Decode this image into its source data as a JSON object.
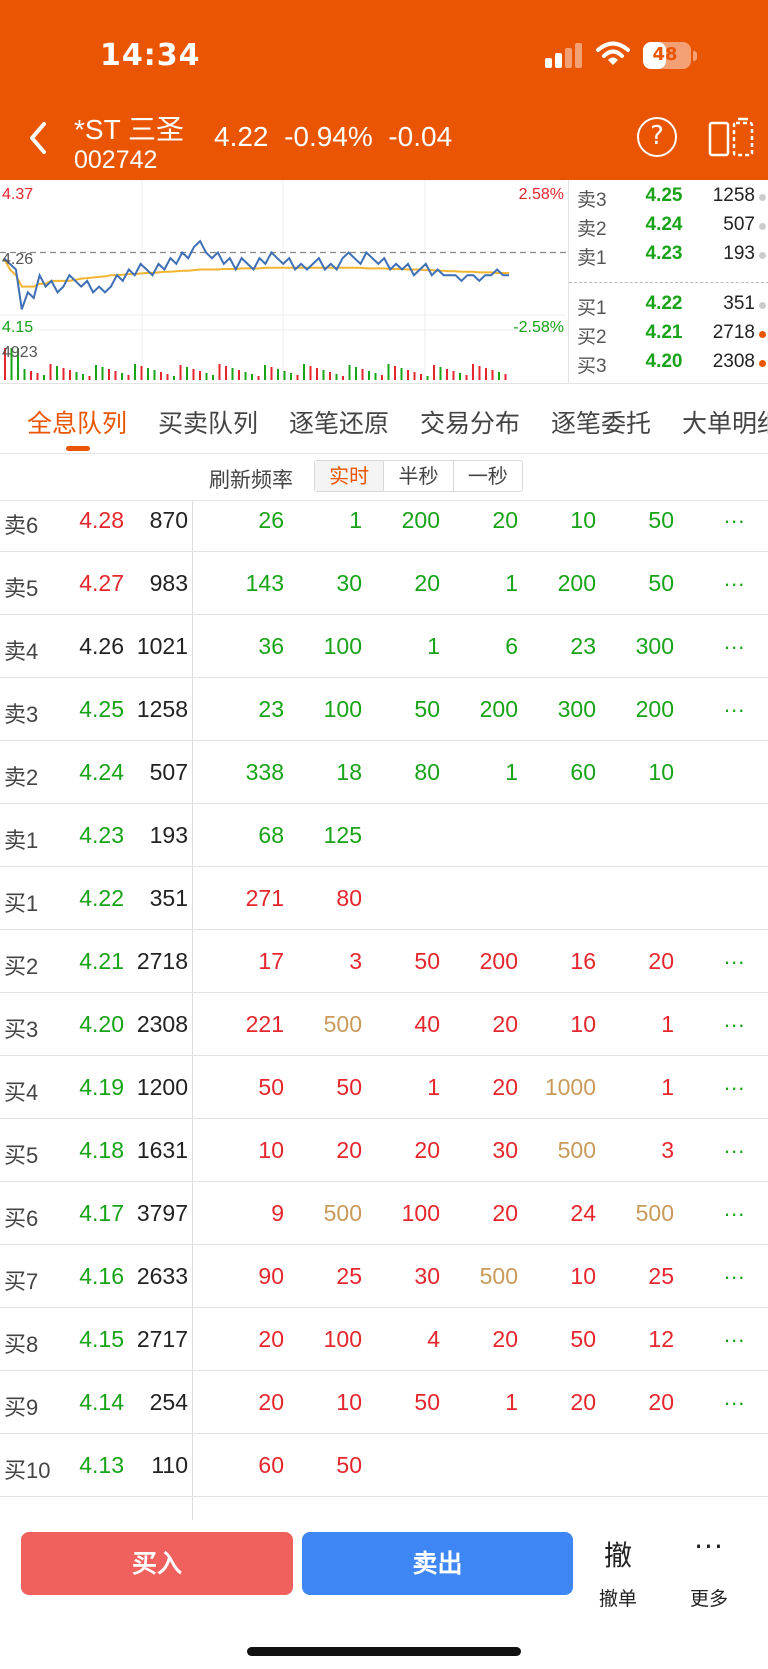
{
  "status_bar": {
    "time": "14:34",
    "battery": "48",
    "battery_level": 0.48
  },
  "header": {
    "name": "*ST 三圣",
    "code": "002742",
    "price": "4.22",
    "change_pct": "-0.94%",
    "change": "-0.04",
    "help_icon": "?"
  },
  "chart": {
    "high_label": "4.37",
    "mid_label": "4.26",
    "low_label": "4.15",
    "up_pct": "2.58%",
    "down_pct": "-2.58%",
    "volume_label": "4923"
  },
  "chart_data": {
    "type": "line",
    "ylim": [
      4.15,
      4.37
    ],
    "reference": 4.26,
    "series": [
      {
        "color": "#3f6fb5",
        "values": [
          4.25,
          4.24,
          4.23,
          4.16,
          4.19,
          4.18,
          4.22,
          4.2,
          4.21,
          4.19,
          4.2,
          4.22,
          4.21,
          4.2,
          4.21,
          4.19,
          4.2,
          4.19,
          4.2,
          4.22,
          4.21,
          4.23,
          4.22,
          4.24,
          4.23,
          4.22,
          4.24,
          4.23,
          4.25,
          4.24,
          4.26,
          4.25,
          4.27,
          4.28,
          4.26,
          4.25,
          4.26,
          4.24,
          4.25,
          4.23,
          4.25,
          4.24,
          4.23,
          4.25,
          4.24,
          4.26,
          4.25,
          4.24,
          4.25,
          4.23,
          4.24,
          4.23,
          4.24,
          4.25,
          4.23,
          4.24,
          4.23,
          4.25,
          4.26,
          4.25,
          4.24,
          4.26,
          4.25,
          4.24,
          4.25,
          4.23,
          4.24,
          4.23,
          4.24,
          4.22,
          4.23,
          4.24,
          4.22,
          4.23,
          4.22,
          4.22,
          4.22,
          4.21,
          4.22,
          4.22,
          4.21,
          4.22,
          4.22,
          4.23,
          4.22,
          4.22
        ]
      },
      {
        "color": "#f2b431",
        "values": [
          4.25,
          4.23,
          4.22,
          4.2,
          4.2,
          4.2,
          4.205,
          4.205,
          4.21,
          4.21,
          4.21,
          4.21,
          4.212,
          4.214,
          4.215,
          4.216,
          4.217,
          4.218,
          4.22,
          4.22,
          4.221,
          4.222,
          4.222,
          4.223,
          4.224,
          4.224,
          4.225,
          4.226,
          4.226,
          4.227,
          4.228,
          4.228,
          4.229,
          4.23,
          4.23,
          4.23,
          4.23,
          4.231,
          4.231,
          4.231,
          4.232,
          4.232,
          4.232,
          4.232,
          4.233,
          4.233,
          4.233,
          4.233,
          4.233,
          4.233,
          4.233,
          4.233,
          4.233,
          4.233,
          4.233,
          4.233,
          4.233,
          4.233,
          4.233,
          4.233,
          4.233,
          4.232,
          4.232,
          4.232,
          4.232,
          4.231,
          4.231,
          4.231,
          4.23,
          4.23,
          4.23,
          4.229,
          4.229,
          4.228,
          4.228,
          4.227,
          4.227,
          4.226,
          4.226,
          4.226,
          4.225,
          4.225,
          4.225,
          4.224,
          4.224,
          4.224
        ]
      }
    ]
  },
  "order_book": [
    {
      "label": "卖3",
      "price": "4.25",
      "volume": "1258",
      "hot": false
    },
    {
      "label": "卖2",
      "price": "4.24",
      "volume": "507",
      "hot": false
    },
    {
      "label": "卖1",
      "price": "4.23",
      "volume": "193",
      "hot": false
    },
    {
      "label": "买1",
      "price": "4.22",
      "volume": "351",
      "hot": false
    },
    {
      "label": "买2",
      "price": "4.21",
      "volume": "2718",
      "hot": true
    },
    {
      "label": "买3",
      "price": "4.20",
      "volume": "2308",
      "hot": true
    }
  ],
  "tabs": [
    "全息队列",
    "买卖队列",
    "逐笔还原",
    "交易分布",
    "逐笔委托",
    "大单明细"
  ],
  "refresh": {
    "label": "刷新频率",
    "options": [
      "实时",
      "半秒",
      "一秒"
    ],
    "active": 0
  },
  "queue": [
    {
      "label": "卖6",
      "price": "4.28",
      "volume": "870",
      "price_color": "red",
      "cells": [
        [
          "26",
          "g"
        ],
        [
          "1",
          "g"
        ],
        [
          "200",
          "g"
        ],
        [
          "20",
          "g"
        ],
        [
          "10",
          "g"
        ],
        [
          "50",
          "g"
        ]
      ],
      "more": true
    },
    {
      "label": "卖5",
      "price": "4.27",
      "volume": "983",
      "price_color": "red",
      "cells": [
        [
          "143",
          "g"
        ],
        [
          "30",
          "g"
        ],
        [
          "20",
          "g"
        ],
        [
          "1",
          "g"
        ],
        [
          "200",
          "g"
        ],
        [
          "50",
          "g"
        ]
      ],
      "more": true
    },
    {
      "label": "卖4",
      "price": "4.26",
      "volume": "1021",
      "price_color": "black",
      "cells": [
        [
          "36",
          "g"
        ],
        [
          "100",
          "g"
        ],
        [
          "1",
          "g"
        ],
        [
          "6",
          "g"
        ],
        [
          "23",
          "g"
        ],
        [
          "300",
          "g"
        ]
      ],
      "more": true
    },
    {
      "label": "卖3",
      "price": "4.25",
      "volume": "1258",
      "price_color": "green",
      "cells": [
        [
          "23",
          "g"
        ],
        [
          "100",
          "g"
        ],
        [
          "50",
          "g"
        ],
        [
          "200",
          "g"
        ],
        [
          "300",
          "g"
        ],
        [
          "200",
          "g"
        ]
      ],
      "more": true
    },
    {
      "label": "卖2",
      "price": "4.24",
      "volume": "507",
      "price_color": "green",
      "cells": [
        [
          "338",
          "g"
        ],
        [
          "18",
          "g"
        ],
        [
          "80",
          "g"
        ],
        [
          "1",
          "g"
        ],
        [
          "60",
          "g"
        ],
        [
          "10",
          "g"
        ]
      ],
      "more": false
    },
    {
      "label": "卖1",
      "price": "4.23",
      "volume": "193",
      "price_color": "green",
      "cells": [
        [
          "68",
          "g"
        ],
        [
          "125",
          "g"
        ]
      ],
      "more": false
    },
    {
      "label": "买1",
      "price": "4.22",
      "volume": "351",
      "price_color": "green",
      "cells": [
        [
          "271",
          "r"
        ],
        [
          "80",
          "r"
        ]
      ],
      "more": false
    },
    {
      "label": "买2",
      "price": "4.21",
      "volume": "2718",
      "price_color": "green",
      "cells": [
        [
          "17",
          "r"
        ],
        [
          "3",
          "r"
        ],
        [
          "50",
          "r"
        ],
        [
          "200",
          "r"
        ],
        [
          "16",
          "r"
        ],
        [
          "20",
          "r"
        ]
      ],
      "more": true
    },
    {
      "label": "买3",
      "price": "4.20",
      "volume": "2308",
      "price_color": "green",
      "cells": [
        [
          "221",
          "r"
        ],
        [
          "500",
          "y"
        ],
        [
          "40",
          "r"
        ],
        [
          "20",
          "r"
        ],
        [
          "10",
          "r"
        ],
        [
          "1",
          "r"
        ]
      ],
      "more": true
    },
    {
      "label": "买4",
      "price": "4.19",
      "volume": "1200",
      "price_color": "green",
      "cells": [
        [
          "50",
          "r"
        ],
        [
          "50",
          "r"
        ],
        [
          "1",
          "r"
        ],
        [
          "20",
          "r"
        ],
        [
          "1000",
          "y"
        ],
        [
          "1",
          "r"
        ]
      ],
      "more": true
    },
    {
      "label": "买5",
      "price": "4.18",
      "volume": "1631",
      "price_color": "green",
      "cells": [
        [
          "10",
          "r"
        ],
        [
          "20",
          "r"
        ],
        [
          "20",
          "r"
        ],
        [
          "30",
          "r"
        ],
        [
          "500",
          "y"
        ],
        [
          "3",
          "r"
        ]
      ],
      "more": true
    },
    {
      "label": "买6",
      "price": "4.17",
      "volume": "3797",
      "price_color": "green",
      "cells": [
        [
          "9",
          "r"
        ],
        [
          "500",
          "y"
        ],
        [
          "100",
          "r"
        ],
        [
          "20",
          "r"
        ],
        [
          "24",
          "r"
        ],
        [
          "500",
          "y"
        ]
      ],
      "more": true
    },
    {
      "label": "买7",
      "price": "4.16",
      "volume": "2633",
      "price_color": "green",
      "cells": [
        [
          "90",
          "r"
        ],
        [
          "25",
          "r"
        ],
        [
          "30",
          "r"
        ],
        [
          "500",
          "y"
        ],
        [
          "10",
          "r"
        ],
        [
          "25",
          "r"
        ]
      ],
      "more": true
    },
    {
      "label": "买8",
      "price": "4.15",
      "volume": "2717",
      "price_color": "green",
      "cells": [
        [
          "20",
          "r"
        ],
        [
          "100",
          "r"
        ],
        [
          "4",
          "r"
        ],
        [
          "20",
          "r"
        ],
        [
          "50",
          "r"
        ],
        [
          "12",
          "r"
        ]
      ],
      "more": true
    },
    {
      "label": "买9",
      "price": "4.14",
      "volume": "254",
      "price_color": "green",
      "cells": [
        [
          "20",
          "r"
        ],
        [
          "10",
          "r"
        ],
        [
          "50",
          "r"
        ],
        [
          "1",
          "r"
        ],
        [
          "20",
          "r"
        ],
        [
          "20",
          "r"
        ]
      ],
      "more": true
    },
    {
      "label": "买10",
      "price": "4.13",
      "volume": "110",
      "price_color": "green",
      "cells": [
        [
          "60",
          "r"
        ],
        [
          "50",
          "r"
        ]
      ],
      "more": false
    }
  ],
  "more_dots": "...",
  "bottom": {
    "buy": "买入",
    "sell": "卖出",
    "cancel_icon": "撤",
    "cancel": "撤单",
    "more_icon": "···",
    "more": "更多"
  },
  "colors": {
    "brand": "#e95502",
    "up": "#e5262c",
    "down": "#18a318",
    "gold": "#c99a5b",
    "buy_button": "#f0605c",
    "sell_button": "#3e86f4"
  }
}
